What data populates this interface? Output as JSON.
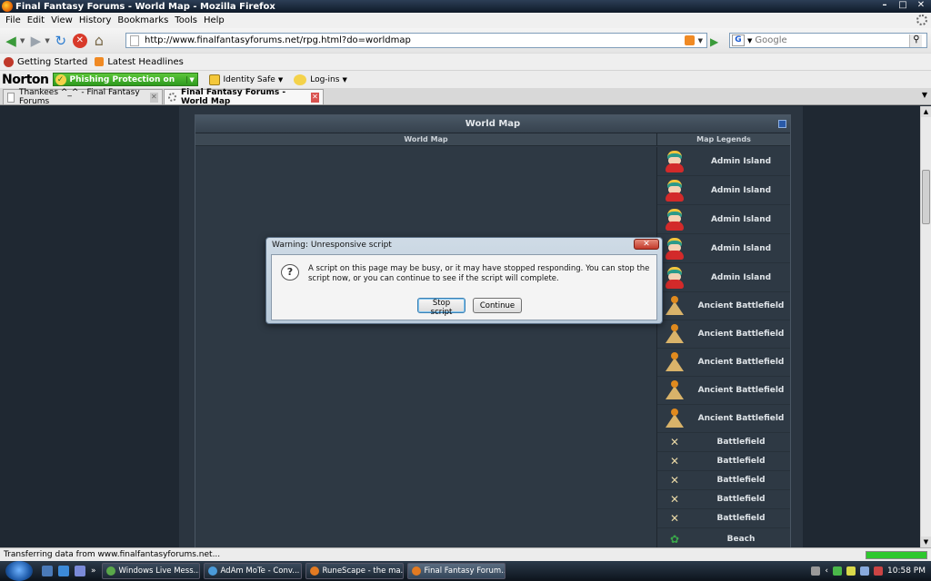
{
  "window": {
    "title": "Final Fantasy Forums - World Map - Mozilla Firefox",
    "controls": [
      "–",
      "□",
      "✕"
    ]
  },
  "menubar": {
    "items": [
      "File",
      "Edit",
      "View",
      "History",
      "Bookmarks",
      "Tools",
      "Help"
    ]
  },
  "navbar": {
    "url": "http://www.finalfantasyforums.net/rpg.html?do=worldmap",
    "search_engine_glyph": "G",
    "search_placeholder": "Google"
  },
  "bookmarks": {
    "items": [
      "Getting Started",
      "Latest Headlines"
    ]
  },
  "norton": {
    "logo": "Norton",
    "phishing": "Phishing Protection on",
    "identity": "Identity Safe",
    "logins": "Log-ins"
  },
  "tabs": [
    {
      "label": "Thankees ^_^ - Final Fantasy Forums",
      "active": false
    },
    {
      "label": "Final Fantasy Forums - World Map",
      "active": true
    }
  ],
  "map": {
    "title": "World Map",
    "col_map": "World Map",
    "col_legend": "Map Legends",
    "legends": [
      {
        "icon": "cartman-icon",
        "name": "Admin Island"
      },
      {
        "icon": "cartman-icon",
        "name": "Admin Island"
      },
      {
        "icon": "cartman-icon",
        "name": "Admin Island"
      },
      {
        "icon": "cartman-icon",
        "name": "Admin Island"
      },
      {
        "icon": "cartman-icon",
        "name": "Admin Island"
      },
      {
        "icon": "pyramid-icon",
        "name": "Ancient Battlefield"
      },
      {
        "icon": "pyramid-icon",
        "name": "Ancient Battlefield"
      },
      {
        "icon": "pyramid-icon",
        "name": "Ancient Battlefield"
      },
      {
        "icon": "pyramid-icon",
        "name": "Ancient Battlefield"
      },
      {
        "icon": "pyramid-icon",
        "name": "Ancient Battlefield"
      },
      {
        "icon": "swords-icon",
        "name": "Battlefield"
      },
      {
        "icon": "swords-icon",
        "name": "Battlefield"
      },
      {
        "icon": "swords-icon",
        "name": "Battlefield"
      },
      {
        "icon": "swords-icon",
        "name": "Battlefield"
      },
      {
        "icon": "swords-icon",
        "name": "Battlefield"
      },
      {
        "icon": "beach-icon",
        "name": "Beach"
      }
    ]
  },
  "dialog": {
    "title": "Warning: Unresponsive script",
    "message": "A script on this page may be busy, or it may have stopped responding. You can stop the script now, or you can continue to see if the script will complete.",
    "stop_label": "Stop script",
    "continue_label": "Continue"
  },
  "status": {
    "text": "Transferring data from www.finalfantasyforums.net...",
    "progress": 1.0
  },
  "taskbar": {
    "tasks": [
      {
        "label": "Windows Live Mess...",
        "icon": "msn-icon"
      },
      {
        "label": "AdAm MoTe - Conv...",
        "icon": "conversation-icon"
      },
      {
        "label": "RuneScape - the ma...",
        "icon": "firefox-icon"
      },
      {
        "label": "Final Fantasy Forum...",
        "icon": "firefox-icon"
      }
    ],
    "clock": "10:58 PM"
  },
  "colors": {
    "page_bg": "#1f2832",
    "panel_bg": "#2f3a45",
    "norton_green": "#2e9a1e",
    "progress_green": "#2ec82e"
  }
}
